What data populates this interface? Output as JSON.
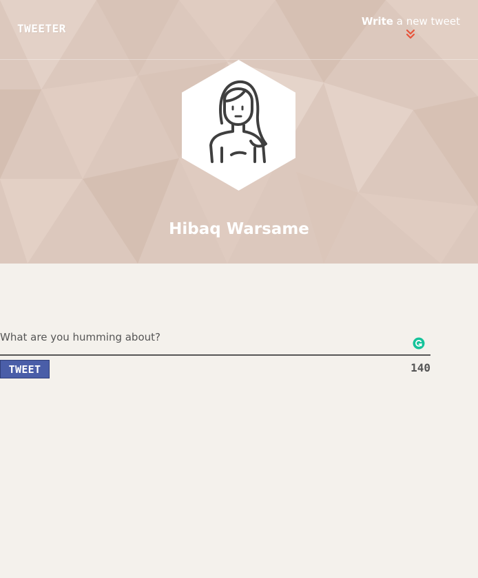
{
  "nav": {
    "brand": "TWEETER",
    "compose_toggle": {
      "strong": "Write",
      "rest": "a new tweet",
      "icon": "double-chevron-down-icon",
      "icon_color": "#e8533a"
    }
  },
  "profile": {
    "name": "Hibaq Warsame",
    "avatar": "woman-avatar-icon"
  },
  "composer": {
    "placeholder": "What are you humming about?",
    "value": "",
    "submit_label": "TWEET",
    "char_count": "140",
    "grammar_icon": "grammarly-icon",
    "grammar_icon_color": "#15c39a"
  },
  "colors": {
    "hero_bg": "#dcc8bd",
    "page_bg": "#f4f1ec",
    "button": "#4a5ea8",
    "text": "#555555"
  }
}
